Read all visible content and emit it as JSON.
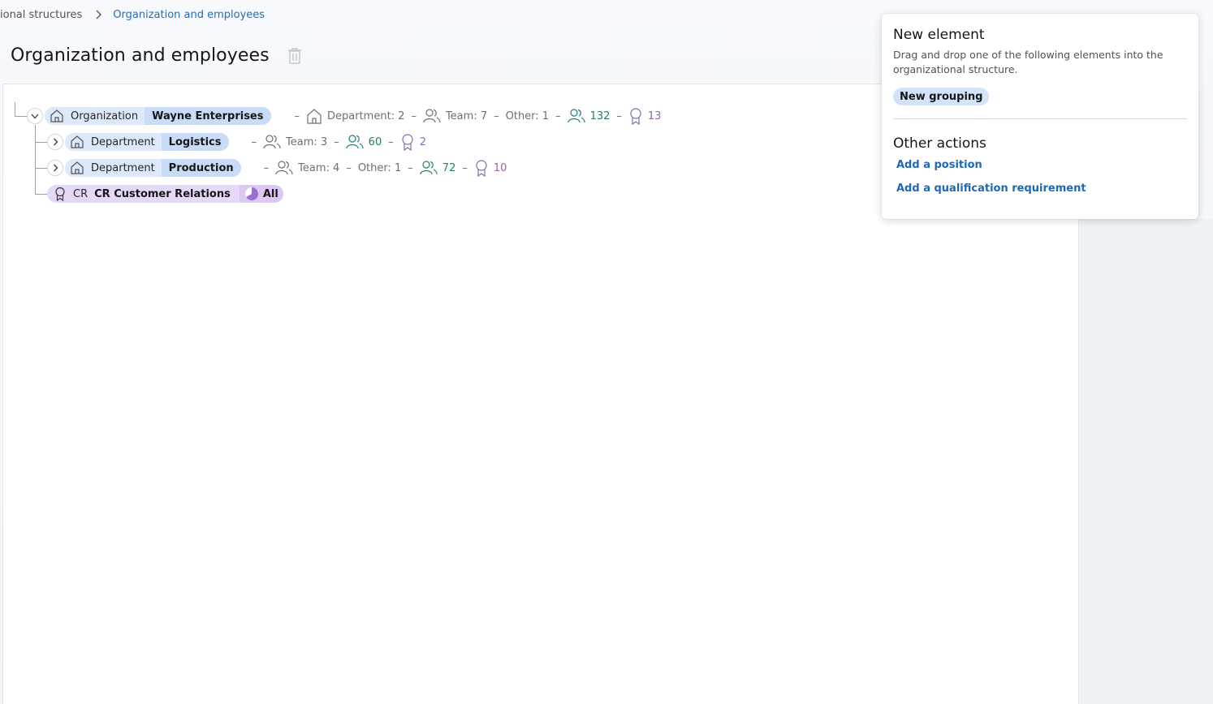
{
  "breadcrumb": {
    "previous": "ional structures",
    "current": "Organization and employees"
  },
  "page": {
    "title": "Organization and employees"
  },
  "tree": {
    "organization": {
      "type_label": "Organization",
      "name": "Wayne Enterprises",
      "stats": {
        "department": "Department: 2",
        "team": "Team: 7",
        "other": "Other: 1",
        "employees": "132",
        "qualifications": "13"
      }
    },
    "departments": [
      {
        "type_label": "Department",
        "name": "Logistics",
        "stats": {
          "team": "Team: 3",
          "employees": "60",
          "qualifications": "2"
        }
      },
      {
        "type_label": "Department",
        "name": "Production",
        "stats": {
          "team": "Team: 4",
          "other": "Other: 1",
          "employees": "72",
          "qualifications": "10"
        }
      }
    ],
    "qualification": {
      "code": "CR",
      "name": "CR Customer Relations",
      "scope": "All"
    }
  },
  "panel": {
    "new_element_title": "New element",
    "new_element_desc": "Drag and drop one of the following elements into the organizational structure.",
    "new_grouping": "New grouping",
    "other_actions_title": "Other actions",
    "add_position": "Add a position",
    "add_qualification": "Add a qualification requirement"
  },
  "colors": {
    "link": "#1e68b8",
    "teal_stat": "#267d75",
    "purple_stat": "#8a6ba6",
    "chip_blue": "#dde8fb",
    "chip_purple": "#e6d8f7"
  }
}
